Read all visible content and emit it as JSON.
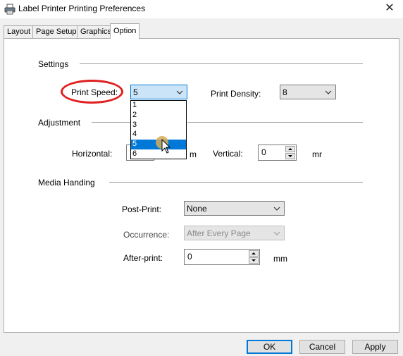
{
  "window": {
    "title": "Label Printer Printing Preferences",
    "close_glyph": "✕",
    "icon": "printer-icon"
  },
  "tabs": [
    {
      "label": "Layout"
    },
    {
      "label": "Page Setup"
    },
    {
      "label": "Graphics"
    },
    {
      "label": "Option",
      "active": true
    }
  ],
  "settings": {
    "group_label": "Settings",
    "print_speed_label": "Print Speed:",
    "print_speed_value": "5",
    "print_speed_options": [
      "1",
      "2",
      "3",
      "4",
      "5",
      "6"
    ],
    "print_speed_selected_index": 4,
    "print_density_label": "Print Density:",
    "print_density_value": "8"
  },
  "adjustment": {
    "group_label": "Adjustment",
    "horizontal_label": "Horizontal:",
    "horizontal_unit": "m",
    "vertical_label": "Vertical:",
    "vertical_value": "0",
    "vertical_unit": "mr"
  },
  "media": {
    "group_label": "Media Handing",
    "post_print_label": "Post-Print:",
    "post_print_value": "None",
    "occurrence_label": "Occurrence:",
    "occurrence_value": "After Every Page",
    "after_print_label": "After-print:",
    "after_print_value": "0",
    "after_print_unit": "mm"
  },
  "buttons": {
    "ok": "OK",
    "cancel": "Cancel",
    "apply": "Apply"
  },
  "colors": {
    "accent": "#0078d7",
    "highlight_ring": "#e02020"
  }
}
